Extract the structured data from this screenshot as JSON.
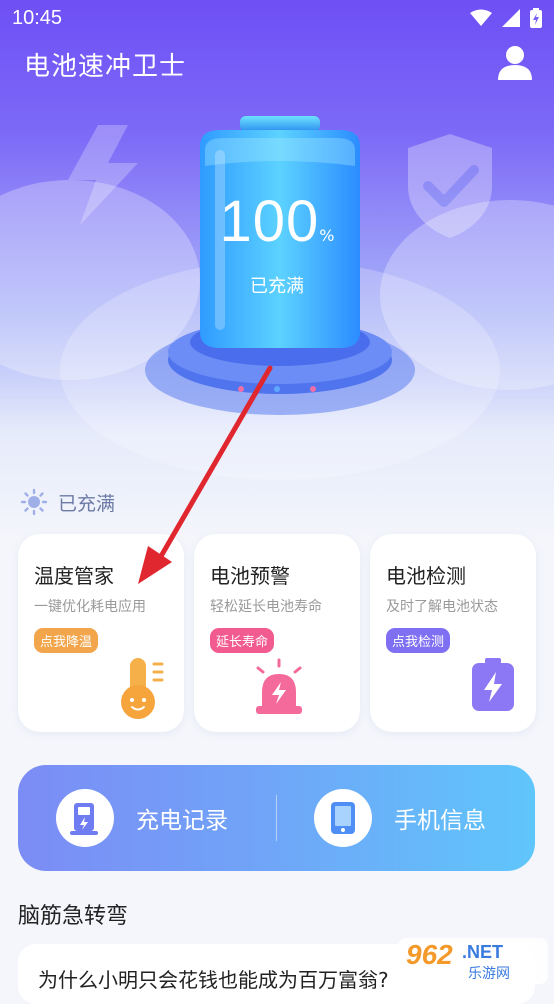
{
  "status_bar": {
    "time": "10:45"
  },
  "header": {
    "title": "电池速冲卫士"
  },
  "battery": {
    "percent": "100",
    "unit": "%",
    "state_label": "已充满",
    "level": 1.0
  },
  "status": {
    "text": "已充满"
  },
  "cards": [
    {
      "title": "温度管家",
      "subtitle": "一键优化耗电应用",
      "badge": "点我降温",
      "badge_color": "#f2a54a",
      "icon": "thermometer-icon"
    },
    {
      "title": "电池预警",
      "subtitle": "轻松延长电池寿命",
      "badge": "延长寿命",
      "badge_color": "#f25b8f",
      "icon": "alarm-icon"
    },
    {
      "title": "电池检测",
      "subtitle": "及时了解电池状态",
      "badge": "点我检测",
      "badge_color": "#7f6ff2",
      "icon": "battery-check-icon"
    }
  ],
  "actions": {
    "charge_record": "充电记录",
    "phone_info": "手机信息"
  },
  "riddle_section": {
    "title": "脑筋急转弯",
    "question": "为什么小明只会花钱也能成为百万富翁?"
  },
  "watermark": {
    "main": "962",
    "domain": ".NET",
    "sub": "乐游网"
  },
  "colors": {
    "accent": "#6e4ff5",
    "bar_start": "#7c8cf5",
    "bar_end": "#5fc6fb",
    "arrow": "#e0262e"
  }
}
